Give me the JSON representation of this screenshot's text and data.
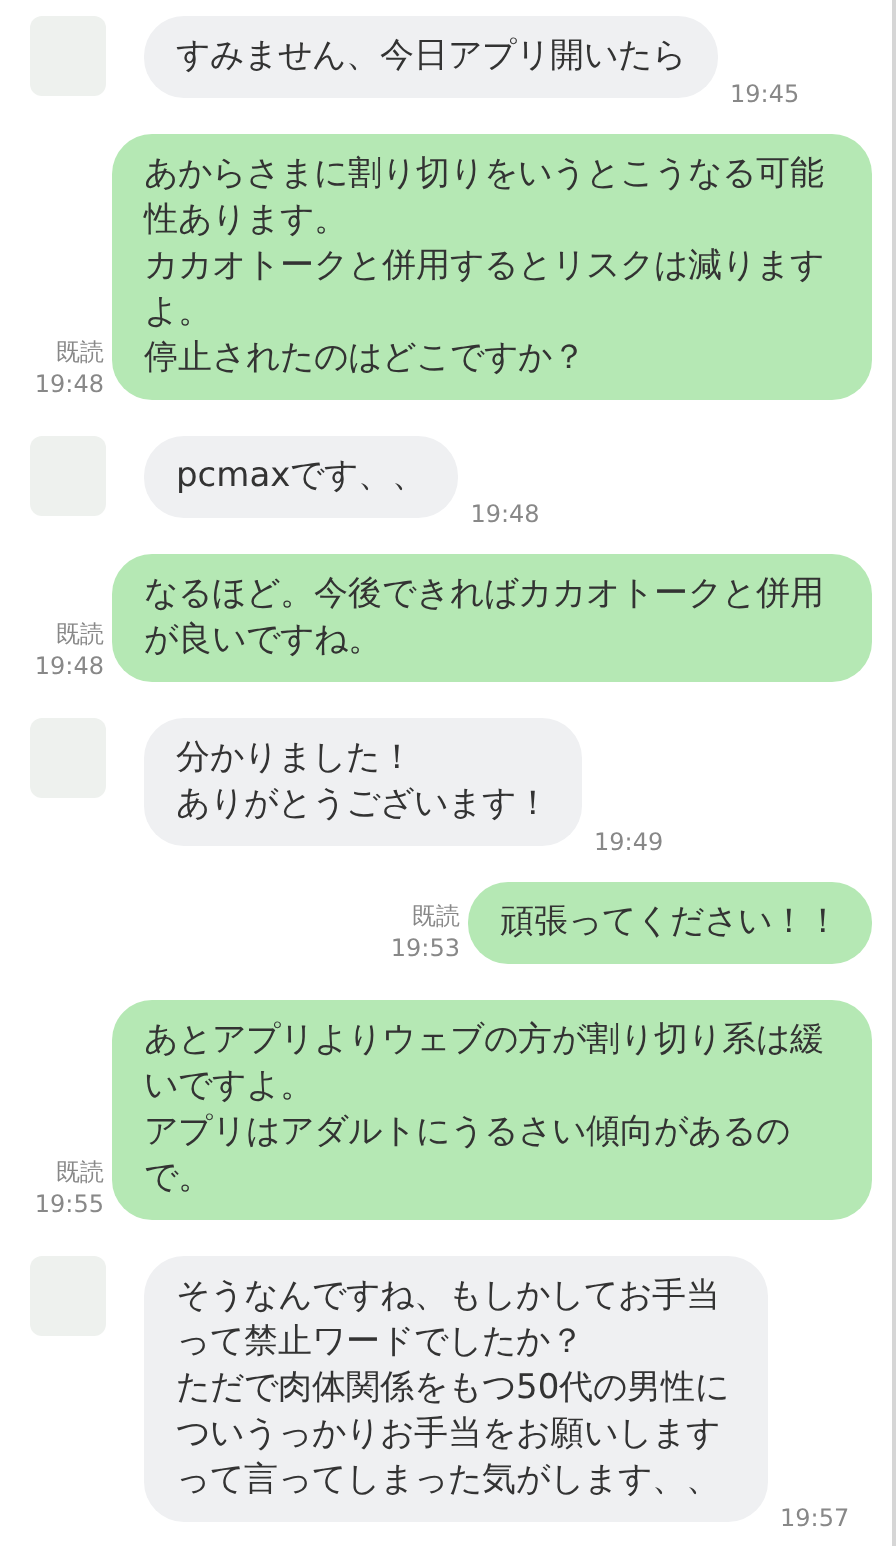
{
  "messages": [
    {
      "kind": "incoming",
      "paragraphs": [
        "すみません、今日アプリ開いたら"
      ],
      "time": "19:45"
    },
    {
      "kind": "outgoing",
      "paragraphs": [
        "あからさまに割り切りをいうとこうなる可能性あります。",
        "カカオトークと併用するとリスクは減りますよ。",
        "停止されたのはどこですか？"
      ],
      "read": "既読",
      "time": "19:48"
    },
    {
      "kind": "incoming",
      "paragraphs": [
        "pcmaxです、、"
      ],
      "time": "19:48"
    },
    {
      "kind": "outgoing",
      "paragraphs": [
        "なるほど。今後できればカカオトークと併用が良いですね。"
      ],
      "read": "既読",
      "time": "19:48"
    },
    {
      "kind": "incoming",
      "paragraphs": [
        "分かりました！",
        "ありがとうございます！"
      ],
      "time": "19:49"
    },
    {
      "kind": "outgoing",
      "paragraphs": [
        "頑張ってください！！"
      ],
      "read": "既読",
      "time": "19:53"
    },
    {
      "kind": "outgoing",
      "paragraphs": [
        "あとアプリよりウェブの方が割り切り系は緩いですよ。",
        "アプリはアダルトにうるさい傾向があるので。"
      ],
      "read": "既読",
      "time": "19:55"
    },
    {
      "kind": "incoming",
      "paragraphs": [
        "そうなんですね、もしかしてお手当って禁止ワードでしたか？",
        "ただで肉体関係をもつ50代の男性についうっかりお手当をお願いしますって言ってしまった気がします、、"
      ],
      "time": "19:57"
    }
  ]
}
